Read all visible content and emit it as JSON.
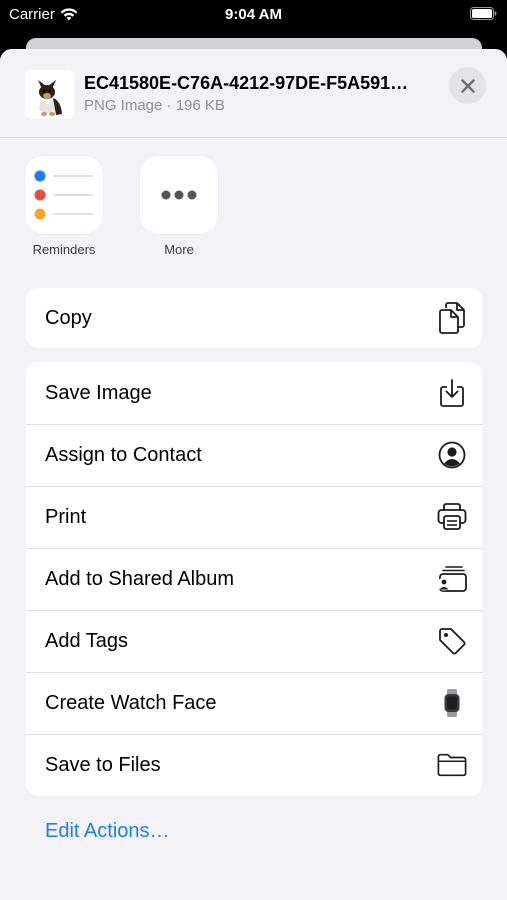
{
  "status_bar": {
    "carrier": "Carrier",
    "time": "9:04 AM"
  },
  "header": {
    "file_title": "EC41580E-C76A-4212-97DE-F5A591…",
    "file_subtitle": "PNG Image · 196 KB",
    "close_icon": "xmark-icon"
  },
  "apps": [
    {
      "label": "Reminders",
      "icon": "reminders-icon"
    },
    {
      "label": "More",
      "icon": "ellipsis-icon"
    }
  ],
  "actions_group_1": [
    {
      "label": "Copy",
      "icon": "copy-icon"
    }
  ],
  "actions_group_2": [
    {
      "label": "Save Image",
      "icon": "save-image-icon"
    },
    {
      "label": "Assign to Contact",
      "icon": "contact-icon"
    },
    {
      "label": "Print",
      "icon": "printer-icon"
    },
    {
      "label": "Add to Shared Album",
      "icon": "shared-album-icon"
    },
    {
      "label": "Add Tags",
      "icon": "tag-icon"
    },
    {
      "label": "Create Watch Face",
      "icon": "watch-icon"
    },
    {
      "label": "Save to Files",
      "icon": "folder-icon"
    }
  ],
  "footer": {
    "edit_actions": "Edit Actions…"
  },
  "colors": {
    "link": "#1a7ef5",
    "sheet_bg": "#f2f2f7",
    "reminder_blue": "#1a7ef5",
    "reminder_red": "#ef4a3a",
    "reminder_orange": "#f5a623"
  }
}
